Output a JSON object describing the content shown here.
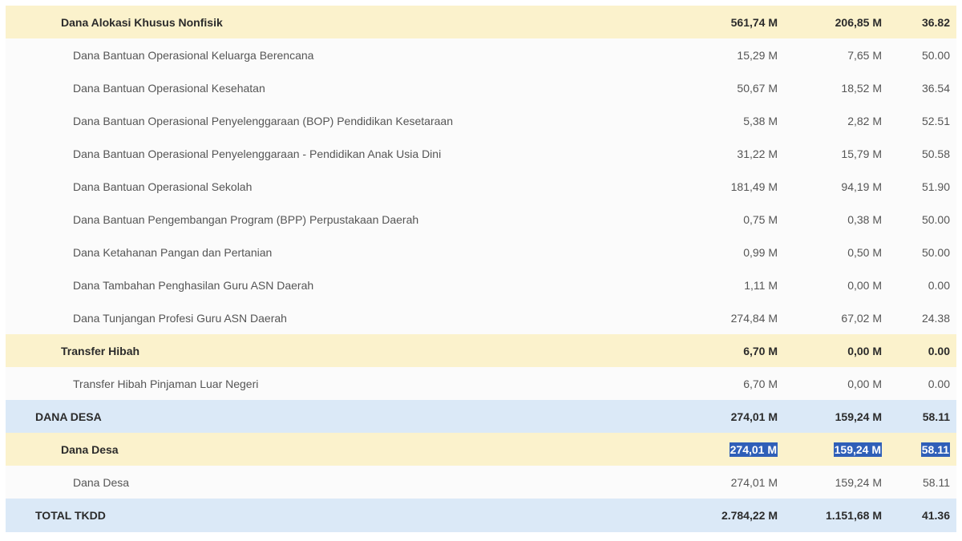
{
  "rows": [
    {
      "type": "cat",
      "level": 1,
      "name": "Dana Alokasi Khusus Nonfisik",
      "pagu": "561,74 M",
      "realisasi": "206,85 M",
      "persen": "36.82"
    },
    {
      "type": "item",
      "level": 2,
      "name": "Dana Bantuan Operasional Keluarga Berencana",
      "pagu": "15,29 M",
      "realisasi": "7,65 M",
      "persen": "50.00"
    },
    {
      "type": "item",
      "level": 2,
      "name": "Dana Bantuan Operasional Kesehatan",
      "pagu": "50,67 M",
      "realisasi": "18,52 M",
      "persen": "36.54"
    },
    {
      "type": "item",
      "level": 2,
      "name": "Dana Bantuan Operasional Penyelenggaraan (BOP) Pendidikan Kesetaraan",
      "pagu": "5,38 M",
      "realisasi": "2,82 M",
      "persen": "52.51"
    },
    {
      "type": "item",
      "level": 2,
      "name": "Dana Bantuan Operasional Penyelenggaraan - Pendidikan Anak Usia Dini",
      "pagu": "31,22 M",
      "realisasi": "15,79 M",
      "persen": "50.58"
    },
    {
      "type": "item",
      "level": 2,
      "name": "Dana Bantuan Operasional Sekolah",
      "pagu": "181,49 M",
      "realisasi": "94,19 M",
      "persen": "51.90"
    },
    {
      "type": "item",
      "level": 2,
      "name": "Dana Bantuan Pengembangan Program (BPP) Perpustakaan Daerah",
      "pagu": "0,75 M",
      "realisasi": "0,38 M",
      "persen": "50.00"
    },
    {
      "type": "item",
      "level": 2,
      "name": "Dana Ketahanan Pangan dan Pertanian",
      "pagu": "0,99 M",
      "realisasi": "0,50 M",
      "persen": "50.00"
    },
    {
      "type": "item",
      "level": 2,
      "name": "Dana Tambahan Penghasilan Guru ASN Daerah",
      "pagu": "1,11 M",
      "realisasi": "0,00 M",
      "persen": "0.00"
    },
    {
      "type": "item",
      "level": 2,
      "name": "Dana Tunjangan Profesi Guru ASN Daerah",
      "pagu": "274,84 M",
      "realisasi": "67,02 M",
      "persen": "24.38"
    },
    {
      "type": "cat",
      "level": 1,
      "name": "Transfer Hibah",
      "pagu": "6,70 M",
      "realisasi": "0,00 M",
      "persen": "0.00"
    },
    {
      "type": "item",
      "level": 2,
      "name": "Transfer Hibah Pinjaman Luar Negeri",
      "pagu": "6,70 M",
      "realisasi": "0,00 M",
      "persen": "0.00"
    },
    {
      "type": "group",
      "level": 0,
      "name": "DANA DESA",
      "pagu": "274,01 M",
      "realisasi": "159,24 M",
      "persen": "58.11"
    },
    {
      "type": "cat",
      "level": 1,
      "name": "Dana Desa",
      "pagu": "274,01 M",
      "realisasi": "159,24 M",
      "persen": "58.11",
      "selected": true
    },
    {
      "type": "item",
      "level": 2,
      "name": "Dana Desa",
      "pagu": "274,01 M",
      "realisasi": "159,24 M",
      "persen": "58.11"
    },
    {
      "type": "group",
      "level": 0,
      "name": "TOTAL TKDD",
      "pagu": "2.784,22 M",
      "realisasi": "1.151,68 M",
      "persen": "41.36"
    }
  ],
  "colors": {
    "category_bg": "#fbf2cc",
    "group_bg": "#dbe9f7",
    "item_bg": "#fbfbfb",
    "selection_bg": "#2f5fb8"
  }
}
